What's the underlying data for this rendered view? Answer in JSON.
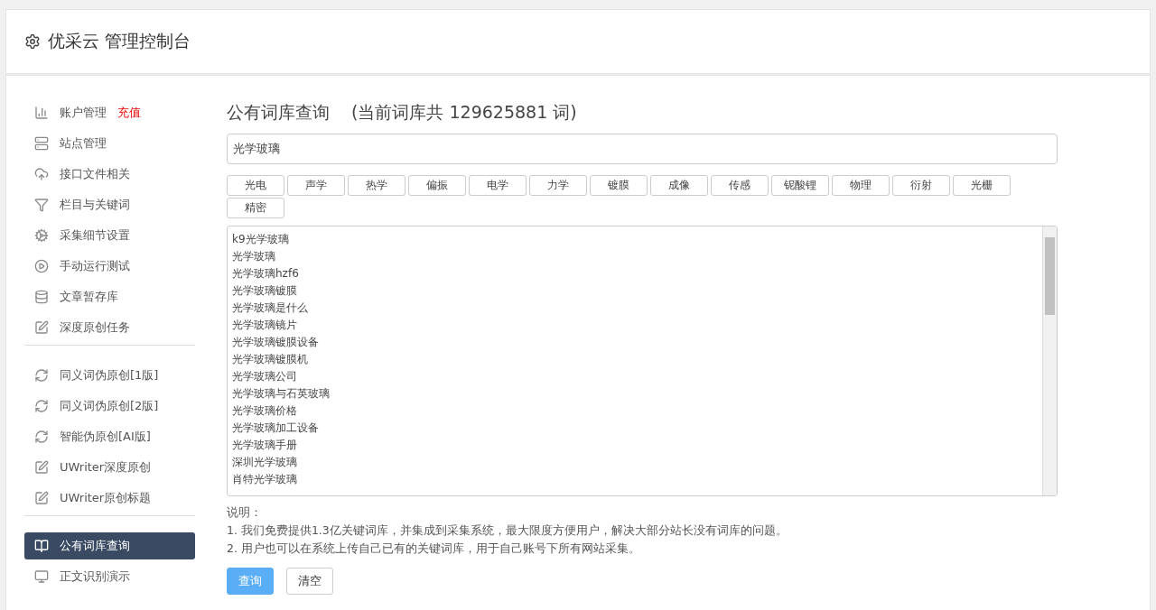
{
  "header": {
    "title": "优采云 管理控制台"
  },
  "sidebar": {
    "groups": [
      {
        "items": [
          {
            "kind": "chart",
            "label": "账户管理",
            "badge": "充值",
            "selected": false
          },
          {
            "kind": "server",
            "label": "站点管理",
            "selected": false
          },
          {
            "kind": "cloud",
            "label": "接口文件相关",
            "selected": false
          },
          {
            "kind": "filter",
            "label": "栏目与关键词",
            "selected": false
          },
          {
            "kind": "gears",
            "label": "采集细节设置",
            "selected": false
          },
          {
            "kind": "play",
            "label": "手动运行测试",
            "selected": false
          },
          {
            "kind": "database",
            "label": "文章暂存库",
            "selected": false
          },
          {
            "kind": "edit",
            "label": "深度原创任务",
            "selected": false
          }
        ]
      },
      {
        "items": [
          {
            "kind": "refresh",
            "label": "同义词伪原创[1版]",
            "selected": false
          },
          {
            "kind": "refresh",
            "label": "同义词伪原创[2版]",
            "selected": false
          },
          {
            "kind": "refresh",
            "label": "智能伪原创[AI版]",
            "selected": false
          },
          {
            "kind": "edit",
            "label": "UWriter深度原创",
            "selected": false
          },
          {
            "kind": "edit",
            "label": "UWriter原创标题",
            "selected": false
          }
        ]
      },
      {
        "items": [
          {
            "kind": "book",
            "label": "公有词库查询",
            "selected": true
          },
          {
            "kind": "monitor",
            "label": "正文识别演示",
            "selected": false
          }
        ]
      }
    ]
  },
  "main": {
    "title": "公有词库查询",
    "subtitle": "(当前词库共 129625881 词)",
    "search": {
      "value": "光学玻璃"
    },
    "tags": [
      "光电",
      "声学",
      "热学",
      "偏振",
      "电学",
      "力学",
      "镀膜",
      "成像",
      "传感",
      "铌酸锂",
      "物理",
      "衍射",
      "光栅",
      "精密"
    ],
    "results": [
      "k9光学玻璃",
      "光学玻璃",
      "光学玻璃hzf6",
      "光学玻璃镀膜",
      "光学玻璃是什么",
      "光学玻璃镜片",
      "光学玻璃镀膜设备",
      "光学玻璃镀膜机",
      "光学玻璃公司",
      "光学玻璃与石英玻璃",
      "光学玻璃价格",
      "光学玻璃加工设备",
      "光学玻璃手册",
      "深圳光学玻璃",
      "肖特光学玻璃"
    ],
    "notes_title": "说明：",
    "notes": [
      "1. 我们免费提供1.3亿关键词库，并集成到采集系统，最大限度方便用户，解决大部分站长没有词库的问题。",
      "2. 用户也可以在系统上传自己已有的关键词库，用于自己账号下所有网站采集。"
    ],
    "buttons": [
      {
        "label": "查询",
        "kind": "primary"
      },
      {
        "label": "清空",
        "kind": "default"
      }
    ]
  }
}
